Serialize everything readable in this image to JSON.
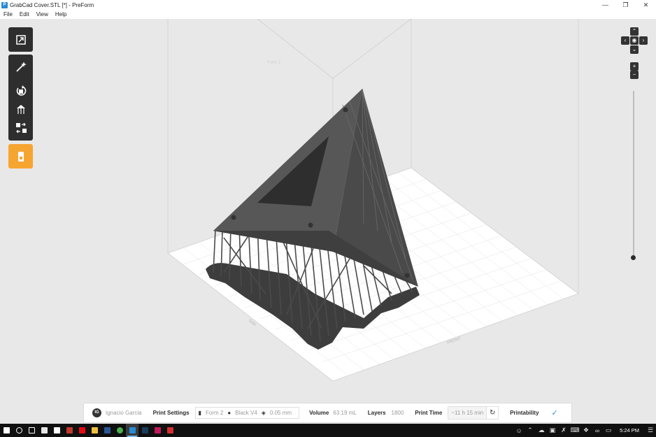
{
  "window": {
    "title": "GrabCad Cover.STL [*] - PreForm",
    "app_icon": "preform-icon",
    "controls": [
      "minimize",
      "maximize",
      "close"
    ]
  },
  "menu": [
    "File",
    "Edit",
    "View",
    "Help"
  ],
  "toolbar": {
    "tools": [
      {
        "name": "fit-view",
        "icon": "expand-arrows-icon"
      },
      {
        "name": "one-click-print",
        "icon": "magic-wand-icon"
      },
      {
        "name": "orientation",
        "icon": "rotate-icon"
      },
      {
        "name": "supports",
        "icon": "supports-icon"
      },
      {
        "name": "layout",
        "icon": "layout-icon"
      },
      {
        "name": "print",
        "icon": "printer-icon"
      }
    ],
    "accent_color": "#f7a531"
  },
  "build_plate": {
    "side_label": "Side",
    "front_label": "FRONT",
    "top_label": "Form 2"
  },
  "status": {
    "user_initials": "IG",
    "user_name": "Ignacio Garcia",
    "print_settings_label": "Print Settings",
    "printer": "Form 2",
    "material": "Black V4",
    "layer_thickness": "0.05 mm",
    "volume_label": "Volume",
    "volume_value": "63.19 mL",
    "layers_label": "Layers",
    "layers_value": "1800",
    "print_time_label": "Print Time",
    "print_time_value": "~11 h 15 min",
    "printability_label": "Printability",
    "printability_icon": "checkmark-icon"
  },
  "taskbar": {
    "clock": "5:24 PM"
  }
}
